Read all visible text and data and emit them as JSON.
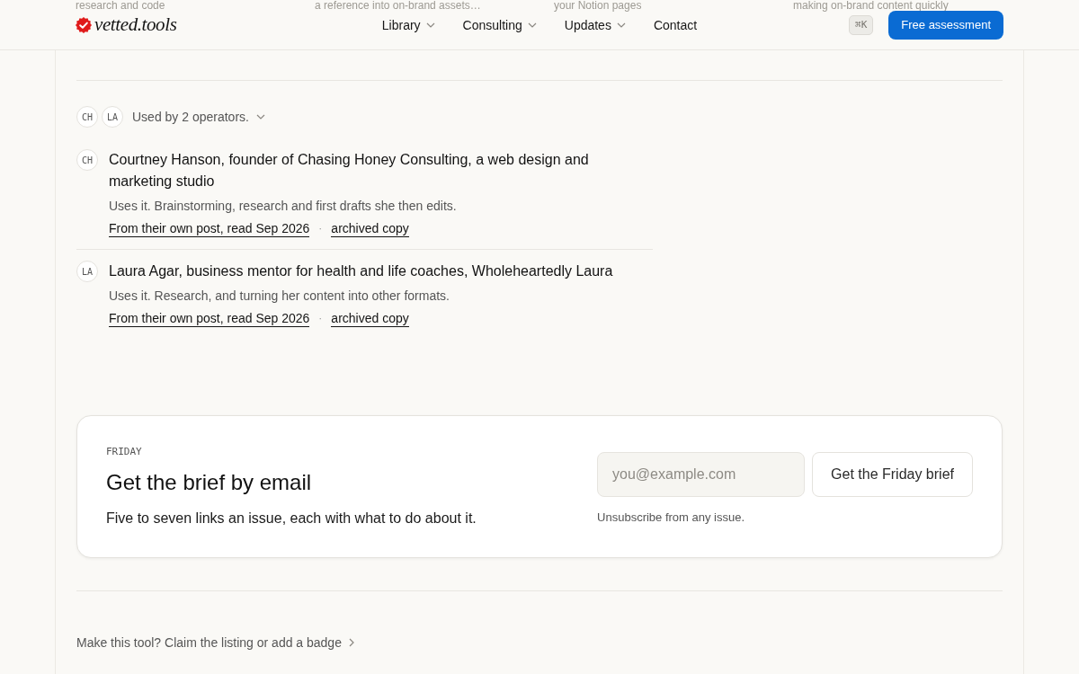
{
  "background_peek": [
    "research and code",
    "a reference into on-brand assets…",
    "your Notion pages",
    "making on-brand content quickly"
  ],
  "header": {
    "logo": "vetted.tools",
    "nav": [
      {
        "label": "Library",
        "kind": "menu"
      },
      {
        "label": "Consulting",
        "kind": "menu"
      },
      {
        "label": "Updates",
        "kind": "menu"
      },
      {
        "label": "Contact",
        "kind": "link"
      }
    ],
    "shortcut": "⌘K",
    "cta": "Free assessment"
  },
  "operators": {
    "avatars": [
      "CH",
      "LA"
    ],
    "summary": "Used by 2 operators.",
    "entries": [
      {
        "initials": "CH",
        "name": "Courtney Hanson, founder of Chasing Honey Consulting, a web design and marketing studio",
        "note": "Uses it. Brainstorming, research and first drafts she then edits.",
        "links": [
          "From their own post, read Sep 2026",
          "archived copy"
        ],
        "separator": "·"
      },
      {
        "initials": "LA",
        "name": "Laura Agar, business mentor for health and life coaches, Wholeheartedly Laura",
        "note": "Uses it. Research, and turning her content into other formats.",
        "links": [
          "From their own post, read Sep 2026",
          "archived copy"
        ],
        "separator": "·"
      }
    ]
  },
  "newsletter": {
    "eyebrow": "FRIDAY",
    "title": "Get the brief by email",
    "text": "Five to seven links an issue, each with what to do about it.",
    "email_placeholder": "you@example.com",
    "button": "Get the Friday brief",
    "note": "Unsubscribe from any issue."
  },
  "footer_link": "Make this tool? Claim the listing or add a badge"
}
